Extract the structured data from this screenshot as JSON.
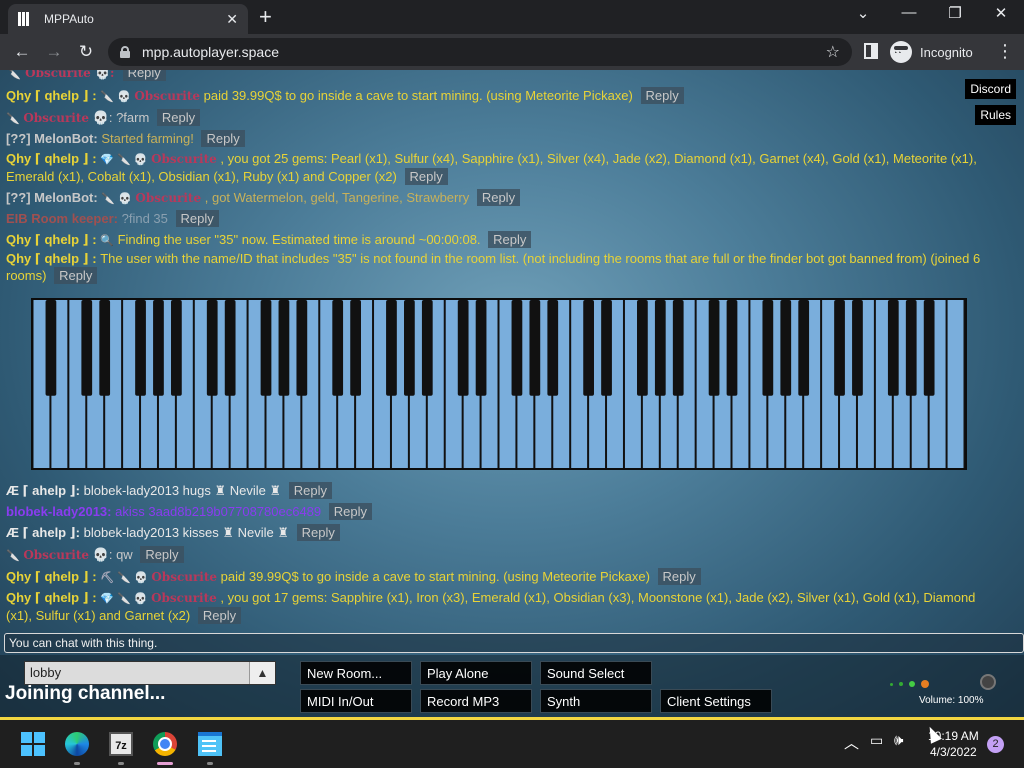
{
  "browser": {
    "tab_title": "MPPAuto",
    "tab_close": "✕",
    "new_tab": "+",
    "url": "mpp.autoplayer.space",
    "incognito_label": "Incognito"
  },
  "top_buttons": {
    "discord": "Discord",
    "rules": "Rules"
  },
  "chat": {
    "reply_label": "Reply",
    "messages": [
      {
        "user": "Qhy ⌈ qhelp ⌋ :",
        "badges": "🔪 💀",
        "obs": "Obscurite",
        "text": "paid 39.99Q$ to go inside a cave to start mining. (using Meteorite Pickaxe)"
      },
      {
        "user": "",
        "badges": "🔪",
        "obs": "Obscurite",
        "text": "💀: ?farm"
      },
      {
        "user": "[??] MelonBot:",
        "badges": "",
        "obs": "",
        "text": "Started farming!"
      },
      {
        "user": "Qhy ⌈ qhelp ⌋ :",
        "badges": "💎 🔪 💀",
        "obs": "Obscurite",
        "text": ", you got 25 gems: Pearl (x1), Sulfur (x4), Sapphire (x1), Silver (x4), Jade (x2), Diamond (x1), Garnet (x4), Gold (x1), Meteorite (x1), Emerald (x1), Cobalt (x1), Obsidian (x1), Ruby (x1) and Copper (x2)"
      },
      {
        "user": "[??] MelonBot:",
        "badges": "🔪 💀",
        "obs": "Obscurite",
        "text": ", got Watermelon, geld, Tangerine, Strawberry"
      },
      {
        "user": "EIB Room keeper:",
        "badges": "",
        "obs": "",
        "text": "?find 35"
      },
      {
        "user": "Qhy ⌈ qhelp ⌋ :",
        "badges": "🔍",
        "obs": "",
        "text": "Finding the user \"35\" now. Estimated time is around ~00:00:08."
      },
      {
        "user": "Qhy ⌈ qhelp ⌋ :",
        "badges": "",
        "obs": "",
        "text": "The user with the name/ID that includes \"35\" is not found in the room list. (not including the rooms that are full or the finder bot got banned from) (joined 6 rooms)"
      },
      {
        "user": "Æ ⌈ ahelp ⌋:",
        "badges": "",
        "obs": "",
        "text": "blobek-lady2013 hugs ♜ Nevile ♜"
      },
      {
        "user": "blobek-lady2013:",
        "badges": "",
        "obs": "",
        "text": "akiss 3aad8b219b07708780ec6489"
      },
      {
        "user": "Æ ⌈ ahelp ⌋:",
        "badges": "",
        "obs": "",
        "text": "blobek-lady2013 kisses ♜ Nevile ♜"
      },
      {
        "user": "",
        "badges": "🔪",
        "obs": "Obscurite",
        "text": "💀: qw"
      },
      {
        "user": "Qhy ⌈ qhelp ⌋ :",
        "badges": "⛏ 🔪 💀",
        "obs": "Obscurite",
        "text": "paid 39.99Q$ to go inside a cave to start mining. (using Meteorite Pickaxe)"
      },
      {
        "user": "Qhy ⌈ qhelp ⌋ :",
        "badges": "💎 🔪 💀",
        "obs": "Obscurite",
        "text": ", you got 17 gems: Sapphire (x1), Iron (x3), Emerald (x1), Obsidian (x3), Moonstone (x1), Jade (x2), Silver (x1), Gold (x1), Diamond (x1), Sulfur (x1) and Garnet (x2)"
      }
    ]
  },
  "chat_input": {
    "placeholder": "You can chat with this thing."
  },
  "controls": {
    "room": "lobby",
    "status": "Joining channel...",
    "buttons": {
      "new_room": "New Room...",
      "play_alone": "Play Alone",
      "sound_select": "Sound Select",
      "midi": "MIDI In/Out",
      "record": "Record MP3",
      "synth": "Synth",
      "client_settings": "Client Settings"
    },
    "volume": "Volume: 100%"
  },
  "piano": {
    "white_key_color": "#7aaedc",
    "black_key_color": "#111111"
  },
  "taskbar": {
    "app_7z": "7z",
    "time": "10:19 AM",
    "date": "4/3/2022",
    "notifications": "2"
  }
}
